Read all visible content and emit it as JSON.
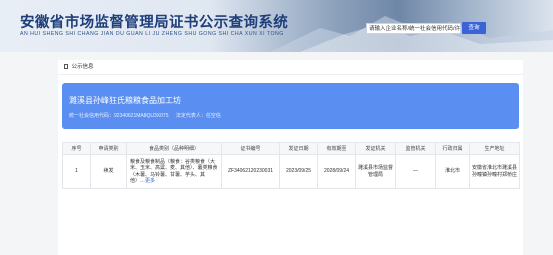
{
  "header": {
    "title": "安徽省市场监督管理局证书公示查询系统",
    "pinyin": "AN HUI SHENG SHI CHANG JIAN DU GUAN LI JU ZHENG SHU GONG SHI CHA XUN XI TONG",
    "search_placeholder": "请输入企业名称/统一社会信用代码/许",
    "search_button": "查询"
  },
  "section": {
    "title": "公示信息"
  },
  "company": {
    "name": "濉溪县孙峰狂氏粮粮食品加工坊",
    "credit_code": "统一社会信用代码：92340621MA8QU3X075",
    "legal_rep": "法定代表人：任空信"
  },
  "table": {
    "headers": [
      "序号",
      "申请类别",
      "食品类别（品种明细）",
      "证书编号",
      "发证日期",
      "有效期至",
      "发证机关",
      "监管机关",
      "行政归属",
      "生产地址"
    ],
    "rows": [
      {
        "index": "1",
        "category": "续发",
        "food_types": "粮食及粮食制品（粮食：谷类粮食（大米、玉米、高粱、麦、其他）、薯类粮食（木薯、马铃薯、甘薯、芋头、其他）…",
        "more": "更多",
        "cert_no": "ZF34062120230031",
        "issue_date": "2023/09/25",
        "valid_until": "2028/09/24",
        "issuer": "濉溪县市场监督管理局",
        "supervisor": "—",
        "admin": "淮北市",
        "address": "安徽省淮北市濉溪县孙疃镇孙疃村郑桥庄"
      }
    ]
  }
}
